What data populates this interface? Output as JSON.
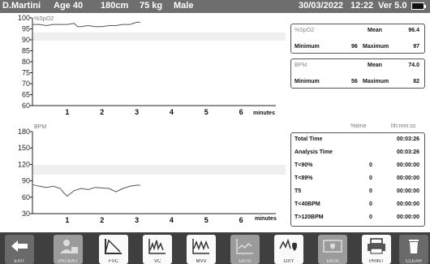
{
  "header": {
    "patient_name": "D.Martini",
    "age": "Age 40",
    "height": "180cm",
    "weight": "75 kg",
    "sex": "Male",
    "date": "30/03/2022",
    "time": "12:22",
    "version": "Ver 5.0"
  },
  "spo2_chart": {
    "label": "%SpO2",
    "y_ticks": [
      "100",
      "95",
      "90",
      "85",
      "80",
      "75",
      "70",
      "65",
      "60"
    ],
    "x_ticks": [
      "1",
      "2",
      "3",
      "4",
      "5",
      "6"
    ],
    "x_unit": "minutes"
  },
  "bpm_chart": {
    "label": "BPM",
    "y_ticks": [
      "180",
      "150",
      "120",
      "90",
      "60",
      "30"
    ],
    "x_ticks": [
      "1",
      "2",
      "3",
      "4",
      "5",
      "6"
    ],
    "x_unit": "minutes"
  },
  "chart_data": [
    {
      "type": "line",
      "series": [
        {
          "x": [
            0,
            0.2,
            0.4,
            0.6,
            0.8,
            1.0,
            1.2,
            1.3,
            1.4,
            1.6,
            1.8,
            2.0,
            2.2,
            2.4,
            2.6,
            2.8,
            3.0,
            3.1
          ],
          "values": [
            97,
            97,
            96.5,
            97,
            97,
            97,
            97.5,
            96,
            96,
            96.5,
            96,
            96,
            96.5,
            96.5,
            97,
            97,
            98,
            98
          ]
        }
      ],
      "xlim": [
        0,
        7
      ],
      "ylim": [
        60,
        100
      ],
      "grid": false
    },
    {
      "type": "line",
      "series": [
        {
          "x": [
            0,
            0.2,
            0.4,
            0.6,
            0.8,
            0.9,
            1.0,
            1.2,
            1.4,
            1.6,
            1.8,
            2.0,
            2.2,
            2.4,
            2.6,
            2.8,
            3.0,
            3.1
          ],
          "values": [
            83,
            80,
            78,
            80,
            76,
            68,
            62,
            72,
            76,
            74,
            78,
            77,
            76,
            70,
            76,
            80,
            82,
            82
          ]
        }
      ],
      "xlim": [
        0,
        7
      ],
      "ylim": [
        30,
        180
      ],
      "grid": false
    }
  ],
  "spo2_stats": {
    "title": "%SpO2",
    "mean_label": "Mean",
    "mean": "96.4",
    "min_label": "Minimum",
    "min": "96",
    "max_label": "Maximum",
    "max": "97"
  },
  "bpm_stats": {
    "title": "BPM",
    "mean_label": "Mean",
    "mean": "74.0",
    "min_label": "Minimum",
    "min": "56",
    "max_label": "Maximum",
    "max": "82"
  },
  "time_table": {
    "col_pct": "%time",
    "col_hms": "hh:mm:ss",
    "rows": [
      {
        "label": "Total Time",
        "pct": "",
        "time": "00:03:26"
      },
      {
        "label": "Analysis Time",
        "pct": "",
        "time": "00:03:26"
      },
      {
        "label": "T<90%",
        "pct": "0",
        "time": "00:00:00"
      },
      {
        "label": "T<89%",
        "pct": "0",
        "time": "00:00:00"
      },
      {
        "label": "T5",
        "pct": "0",
        "time": "00:00:00"
      },
      {
        "label": "T<40BPM",
        "pct": "0",
        "time": "00:00:00"
      },
      {
        "label": "T>120BPM",
        "pct": "0",
        "time": "00:00:00"
      }
    ]
  },
  "toolbar": {
    "exit": "EXIT",
    "patient": "PATIENT",
    "fvc": "FVC",
    "vc": "VC",
    "mvv": "MVV",
    "data_disabled": "DATA",
    "oxy": "OXY",
    "data": "DATA",
    "print": "PRINT",
    "clear": "CLEAR"
  },
  "colors": {
    "header_bg": "#6e6e6e",
    "toolbar_bg": "#3f3f3f",
    "line": "#555555",
    "band": "#efefef"
  }
}
